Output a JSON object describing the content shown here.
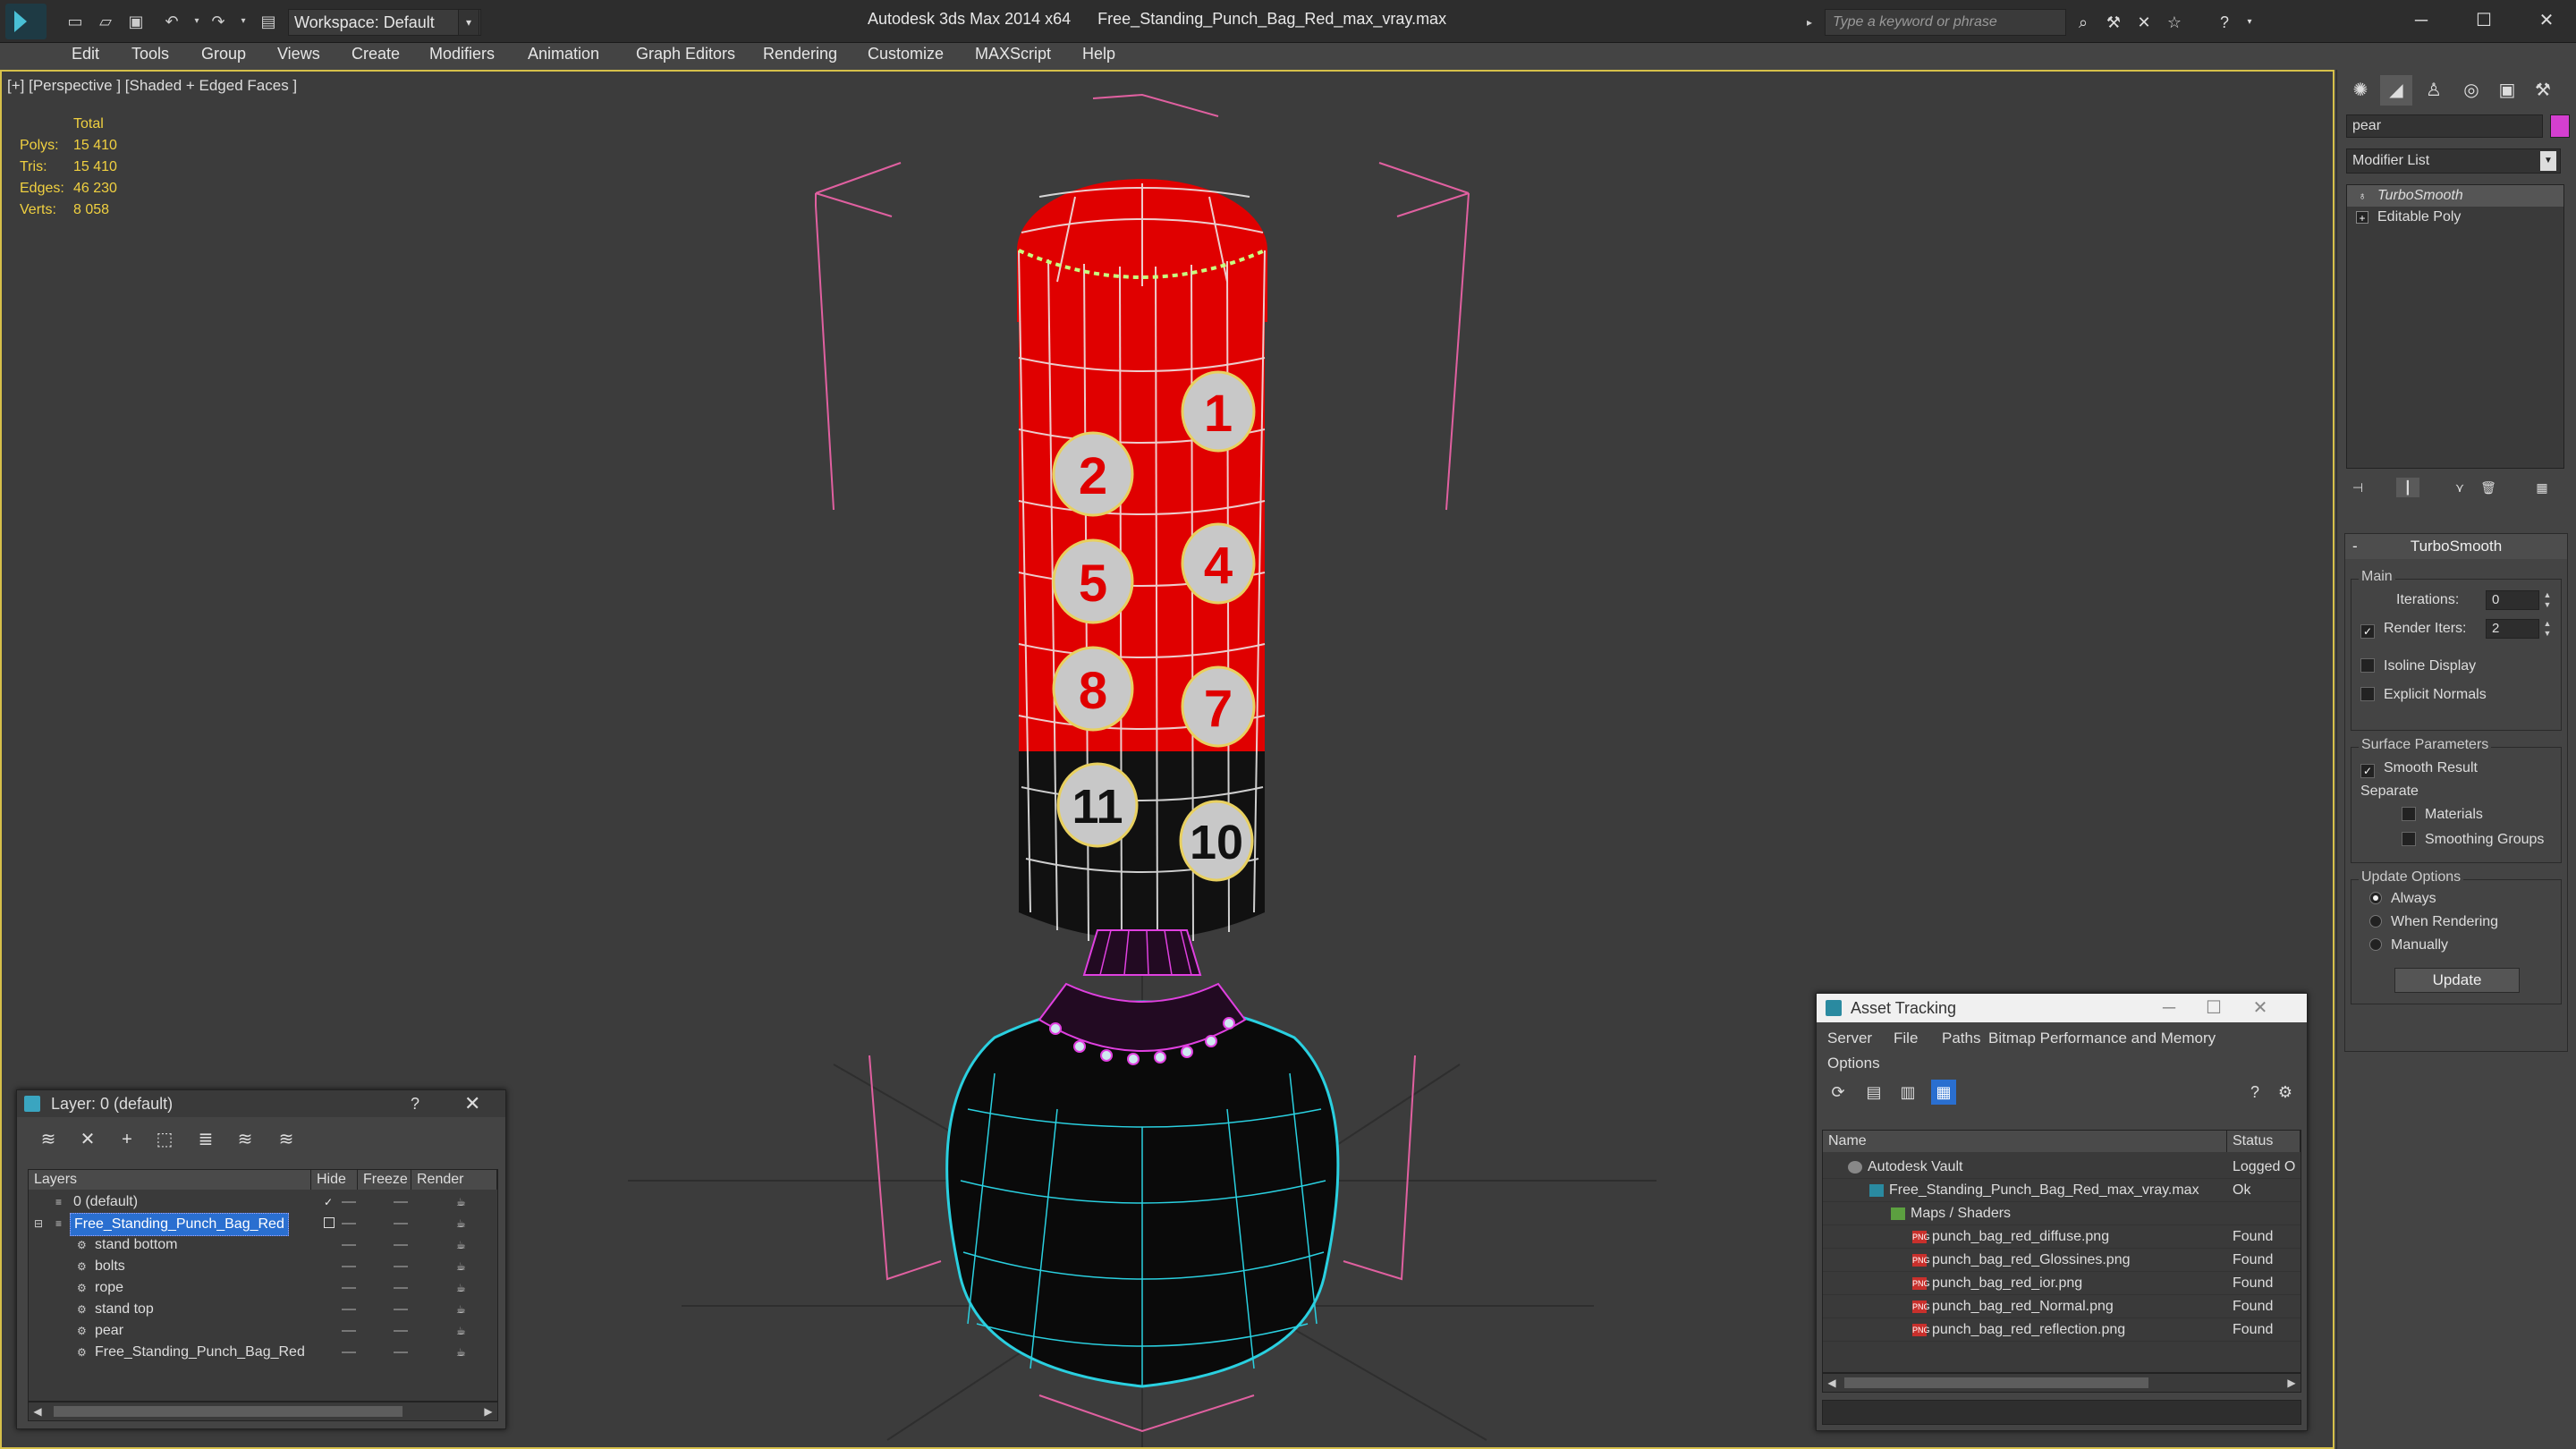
{
  "window": {
    "app_title": "Autodesk 3ds Max 2014 x64",
    "file_title": "Free_Standing_Punch_Bag_Red_max_vray.max",
    "workspace": "Workspace: Default",
    "search_placeholder": "Type a keyword or phrase"
  },
  "menu": [
    "Edit",
    "Tools",
    "Group",
    "Views",
    "Create",
    "Modifiers",
    "Animation",
    "Graph Editors",
    "Rendering",
    "Customize",
    "MAXScript",
    "Help"
  ],
  "viewport": {
    "label": "[+] [Perspective ] [Shaded + Edged Faces ]",
    "stats": {
      "header": "Total",
      "polys_label": "Polys:",
      "polys": "15 410",
      "tris_label": "Tris:",
      "tris": "15 410",
      "edges_label": "Edges:",
      "edges": "46 230",
      "verts_label": "Verts:",
      "verts": "8 058"
    },
    "bag_numbers": [
      "1",
      "2",
      "5",
      "4",
      "8",
      "7",
      "11",
      "10"
    ]
  },
  "command_panel": {
    "object_name": "pear",
    "object_color": "#d43fd0",
    "modifier_list": "Modifier List",
    "stack": [
      "TurboSmooth",
      "Editable Poly"
    ],
    "rollout_title": "TurboSmooth",
    "main_group": "Main",
    "iterations_label": "Iterations:",
    "iterations_value": "0",
    "render_iters_label": "Render Iters:",
    "render_iters_value": "2",
    "isoline_display": "Isoline Display",
    "explicit_normals": "Explicit Normals",
    "surface_group": "Surface Parameters",
    "smooth_result": "Smooth Result",
    "separate_label": "Separate",
    "materials": "Materials",
    "smoothing_groups": "Smoothing Groups",
    "update_group": "Update Options",
    "always": "Always",
    "when_rendering": "When Rendering",
    "manually": "Manually",
    "update_button": "Update"
  },
  "layer_panel": {
    "title": "Layer: 0 (default)",
    "help": "?",
    "columns": [
      "Layers",
      "Hide",
      "Freeze",
      "Render"
    ],
    "rows": [
      {
        "name": "0 (default)"
      },
      {
        "name": "Free_Standing_Punch_Bag_Red"
      },
      {
        "name": "stand bottom"
      },
      {
        "name": "bolts"
      },
      {
        "name": "rope"
      },
      {
        "name": "stand top"
      },
      {
        "name": "pear"
      },
      {
        "name": "Free_Standing_Punch_Bag_Red"
      }
    ]
  },
  "asset_panel": {
    "title": "Asset Tracking",
    "menu": [
      "Server",
      "File",
      "Paths",
      "Bitmap Performance and Memory",
      "Options"
    ],
    "columns": [
      "Name",
      "Status"
    ],
    "rows": [
      {
        "name": "Autodesk Vault",
        "status": "Logged O"
      },
      {
        "name": "Free_Standing_Punch_Bag_Red_max_vray.max",
        "status": "Ok"
      },
      {
        "name": "Maps / Shaders",
        "status": ""
      },
      {
        "name": "punch_bag_red_diffuse.png",
        "status": "Found"
      },
      {
        "name": "punch_bag_red_Glossines.png",
        "status": "Found"
      },
      {
        "name": "punch_bag_red_ior.png",
        "status": "Found"
      },
      {
        "name": "punch_bag_red_Normal.png",
        "status": "Found"
      },
      {
        "name": "punch_bag_red_reflection.png",
        "status": "Found"
      }
    ],
    "png_tag": "PNG"
  },
  "colors": {
    "bag_red": "#e00000",
    "wire_cyan": "#2ad0e0",
    "wire_magenta": "#e040e0",
    "selection_yellow": "#d6c04a",
    "bbox_pink": "#e060a0"
  }
}
